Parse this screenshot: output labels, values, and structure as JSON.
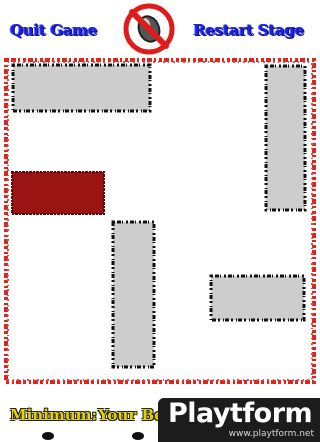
{
  "header": {
    "quit_label": "Quit Game",
    "restart_label": "Restart Stage",
    "sound_icon": "mute-sound-icon"
  },
  "footer": {
    "minimum_label": "Minimum:",
    "your_best_label": "Your Bes"
  },
  "watermark": {
    "logo": "Playtform",
    "url": "www.playtform.net"
  },
  "colors": {
    "button_text": "#1a22e0",
    "border_red": "#e0241c",
    "block_gray": "#cdcdcd",
    "target_block": "#9a1414",
    "footer_text": "#e6d200"
  }
}
